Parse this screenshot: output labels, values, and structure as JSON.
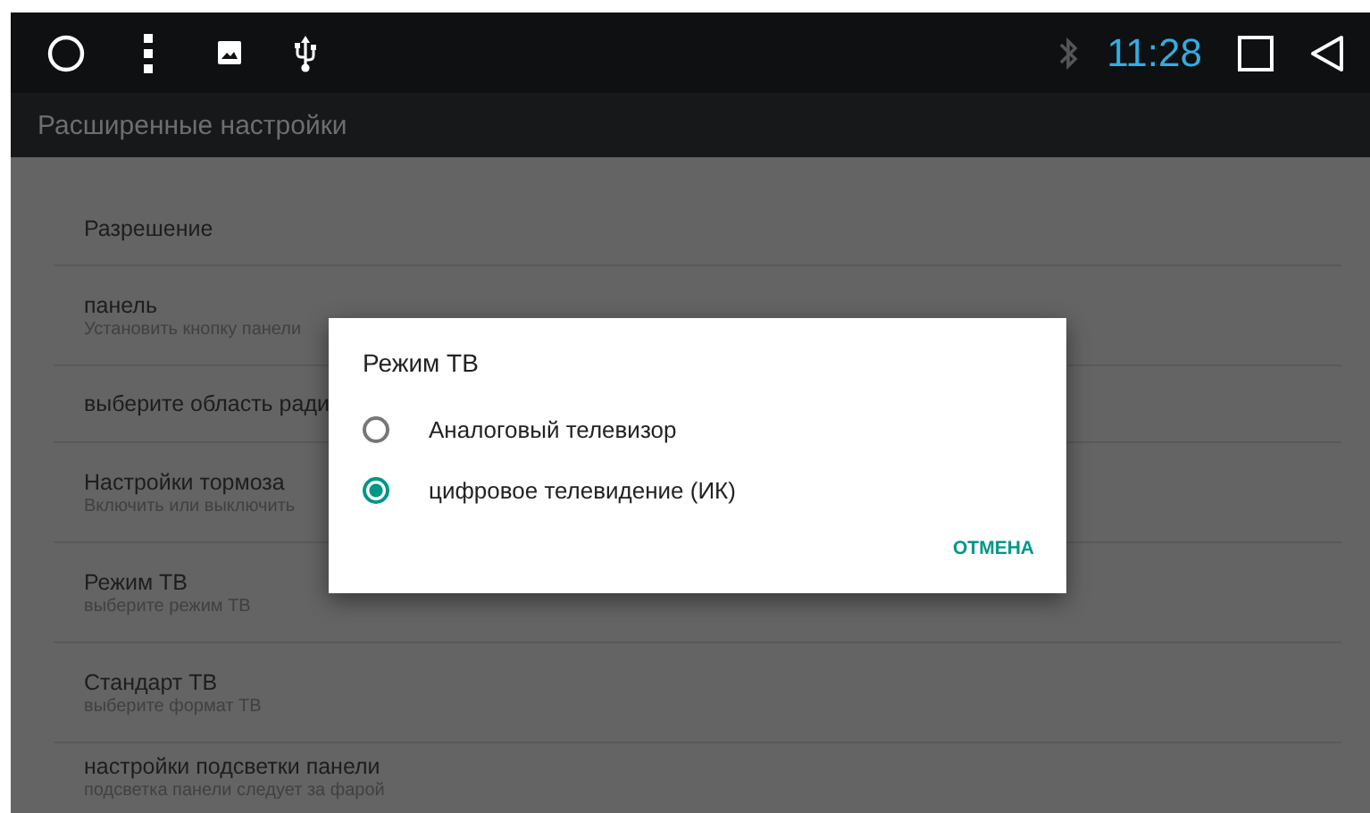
{
  "status_bar": {
    "time": "11:28"
  },
  "toolbar": {
    "title": "Расширенные настройки"
  },
  "settings": [
    {
      "title": "Разрешение"
    },
    {
      "title": "панель",
      "subtitle": "Установить кнопку панели"
    },
    {
      "title": "выберите область ради"
    },
    {
      "title": "Настройки тормоза",
      "subtitle": "Включить или выключить"
    },
    {
      "title": "Режим ТВ",
      "subtitle": "выберите режим ТВ"
    },
    {
      "title": "Стандарт ТВ",
      "subtitle": "выберите формат ТВ"
    },
    {
      "title": "настройки подсветки панели",
      "subtitle": "подсветка панели следует за фарой"
    }
  ],
  "dialog": {
    "title": "Режим ТВ",
    "options": [
      {
        "label": "Аналоговый телевизор",
        "selected": false
      },
      {
        "label": "цифровое телевидение (ИК)",
        "selected": true
      }
    ],
    "buttons": [
      "ОТМЕНА"
    ]
  }
}
